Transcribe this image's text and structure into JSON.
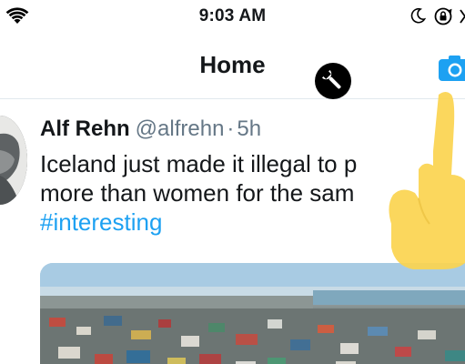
{
  "status_bar": {
    "time": "9:03 AM",
    "icons": [
      "wifi-icon",
      "moon-icon",
      "rotation-lock-icon",
      "battery-icon"
    ]
  },
  "nav": {
    "title": "Home",
    "left_icon": "wrench-icon",
    "right_icon": "camera-icon"
  },
  "tweet": {
    "author_name": "Alf Rehn",
    "author_handle": "@alfrehn",
    "separator": "·",
    "time": "5h",
    "lines": [
      "Iceland just made it illegal to p",
      "more than women for the sam"
    ],
    "hashtag": "#interesting",
    "media": {
      "type": "photo",
      "icon": "city-photo"
    }
  },
  "colors": {
    "text": "#14171a",
    "secondary_text": "#657786",
    "link_blue": "#1da1f2",
    "camera_blue": "#1da1f2",
    "touch_hand": "#fbd44f",
    "divider": "#e1e8ed"
  }
}
